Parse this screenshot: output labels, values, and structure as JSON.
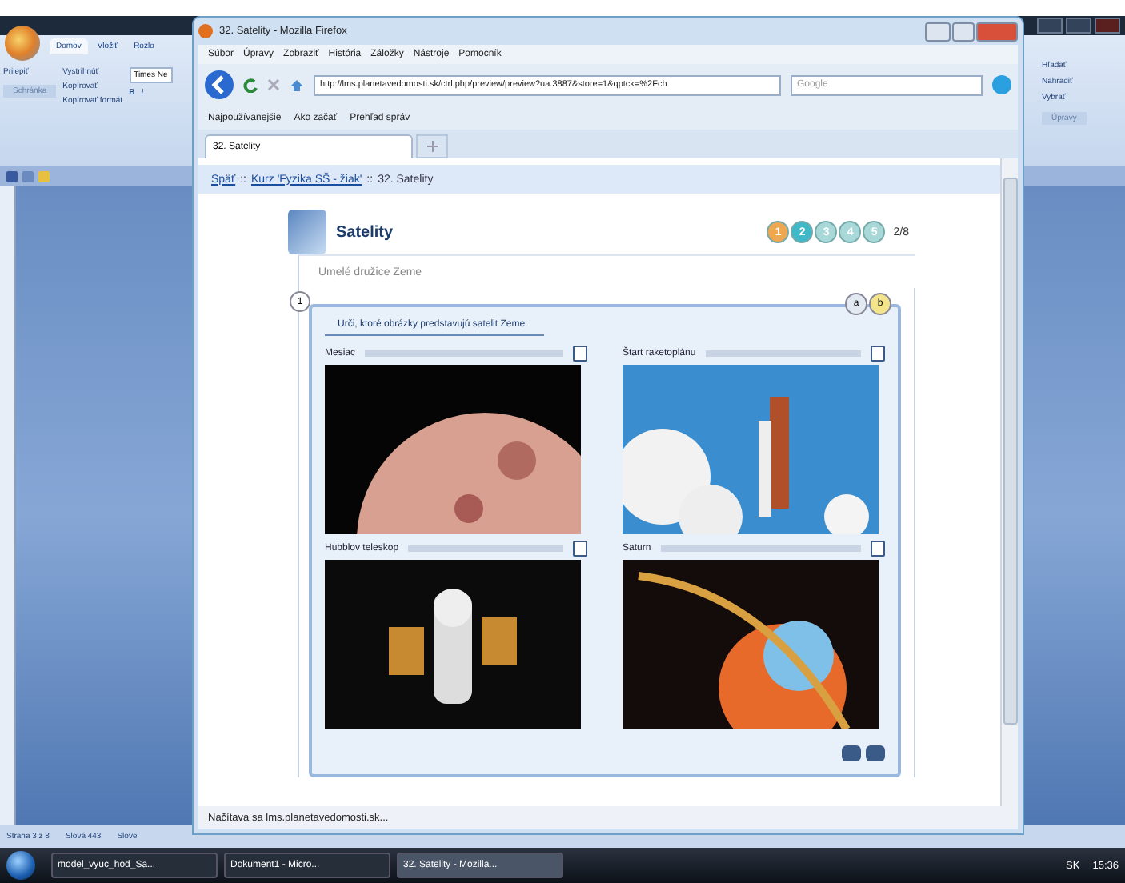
{
  "word": {
    "tabs": [
      {
        "label": "Domov",
        "selected": true
      },
      {
        "label": "Vložiť",
        "selected": false
      },
      {
        "label": "Rozlo",
        "selected": false
      }
    ],
    "clipboard": {
      "paste": "Prilepiť",
      "cut": "Vystrihnúť",
      "copy": "Kopírovať",
      "format_painter": "Kopírovať formát",
      "group": "Schránka"
    },
    "font_name": "Times Ne",
    "bold": "B",
    "italic": "I",
    "editing": {
      "find": "Hľadať",
      "replace": "Nahradiť",
      "select": "Vybrať",
      "group": "Úpravy"
    },
    "status": {
      "page": "Strana 3 z 8",
      "words": "Slová 443",
      "language": "Slove"
    }
  },
  "firefox": {
    "title": "32. Satelity - Mozilla Firefox",
    "menu": [
      "Súbor",
      "Úpravy",
      "Zobraziť",
      "História",
      "Záložky",
      "Nástroje",
      "Pomocník"
    ],
    "url": "http://lms.planetavedomosti.sk/ctrl.php/preview/preview?ua.3887&store=1&qptck=%2Fch",
    "search": {
      "placeholder": "Google"
    },
    "bookmarks": [
      "Najpoužívanejšie",
      "Ako začať",
      "Prehľad správ"
    ],
    "tabs": [
      {
        "label": "32. Satelity",
        "selected": true
      }
    ],
    "breadcrumb": [
      {
        "label": "Späť",
        "link": true
      },
      {
        "label": "Kurz 'Fyzika SŠ - žiak'",
        "link": true
      },
      {
        "label": "32. Satelity",
        "link": false
      }
    ],
    "breadcrumb_separator": "::",
    "status": "Načítava sa lms.planetavedomosti.sk..."
  },
  "lesson": {
    "title": "Satelity",
    "subtitle": "Umelé družice Zeme",
    "pages": [
      {
        "label": "1",
        "color": "#f0a850"
      },
      {
        "label": "2",
        "color": "#40b8c8"
      },
      {
        "label": "3",
        "color": "#a8d8d8"
      },
      {
        "label": "4",
        "color": "#a8d8d8"
      },
      {
        "label": "5",
        "color": "#a8d8d8"
      }
    ],
    "page_counter": "2/8",
    "step": "1",
    "variants": [
      {
        "label": "a",
        "selected": false
      },
      {
        "label": "b",
        "selected": true
      }
    ],
    "instruction": "Urči, ktoré obrázky predstavujú satelit Zeme.",
    "options": [
      {
        "label": "Mesiac",
        "checked": false,
        "kind": "moon"
      },
      {
        "label": "Štart raketoplánu",
        "checked": false,
        "kind": "shuttle"
      },
      {
        "label": "Hubblov teleskop",
        "checked": false,
        "kind": "telescope"
      },
      {
        "label": "Saturn",
        "checked": false,
        "kind": "saturn"
      }
    ]
  },
  "taskbar": {
    "items": [
      {
        "label": "model_vyuc_hod_Sa...",
        "selected": false
      },
      {
        "label": "Dokument1 - Micro...",
        "selected": false
      },
      {
        "label": "32. Satelity - Mozilla...",
        "selected": true
      }
    ],
    "language": "SK",
    "time": "15:36"
  }
}
